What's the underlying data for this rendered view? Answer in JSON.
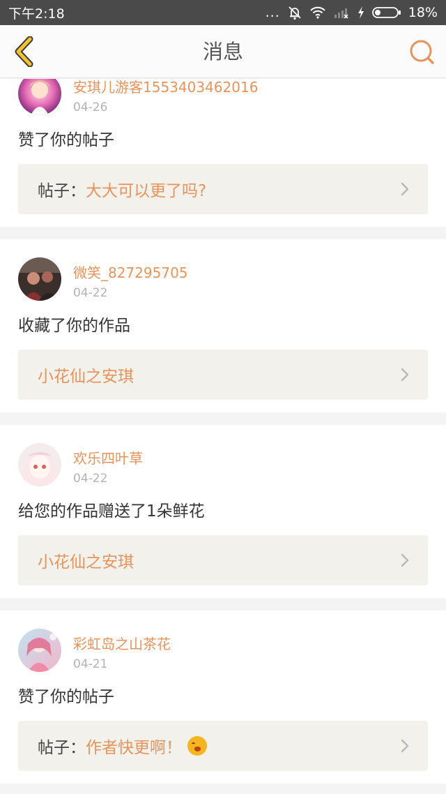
{
  "status_bar": {
    "time": "下午2:18",
    "battery": "18%",
    "dots": "..."
  },
  "header": {
    "title": "消息",
    "back_icon": "chevron-left-icon",
    "search_icon": "search-icon"
  },
  "accent_color": "#e8935a",
  "messages": [
    {
      "user": "安琪儿游客1553403462016",
      "date": "04-26",
      "action": "赞了你的帖子",
      "prefix": "帖子：",
      "target": "大大可以更了吗?"
    },
    {
      "user": "微笑_827295705",
      "date": "04-22",
      "action": "收藏了你的作品",
      "prefix": "",
      "target": "小花仙之安琪"
    },
    {
      "user": "欢乐四叶草",
      "date": "04-22",
      "action": "给您的作品赠送了1朵鲜花",
      "prefix": "",
      "target": "小花仙之安琪"
    },
    {
      "user": "彩虹岛之山茶花",
      "date": "04-21",
      "action": "赞了你的帖子",
      "prefix": "帖子：",
      "target": "作者快更啊！"
    }
  ]
}
